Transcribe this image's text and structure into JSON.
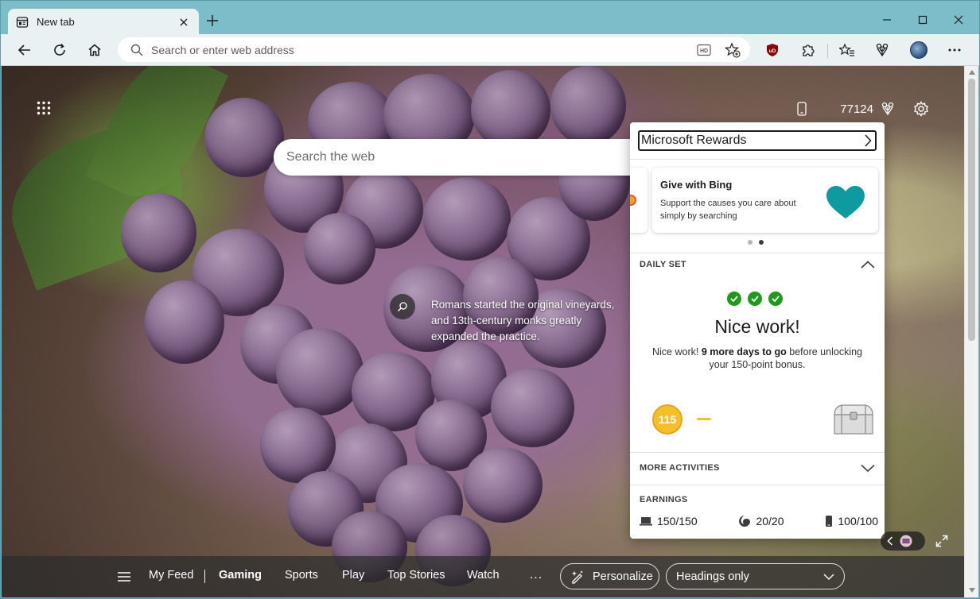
{
  "browser": {
    "tab": {
      "title": "New tab",
      "icon": "newtab-page-icon"
    },
    "address_bar": {
      "placeholder": "Search or enter web address",
      "icon": "search-icon"
    },
    "extensions": [
      "ublock-origin-icon",
      "puzzle-extensions-icon",
      "favorites-icon",
      "rewards-trophy-icon",
      "profile-avatar"
    ],
    "accent_color": "#7dbdc9",
    "ublock_badge_text": "uD"
  },
  "newtab": {
    "points": "77124",
    "search": {
      "placeholder": "Search the web"
    },
    "image_info": "Romans started the original vineyards, and 13th-century monks greatly expanded the practice."
  },
  "rewards": {
    "header": "Microsoft Rewards",
    "promo": {
      "title": "Give with Bing",
      "description": "Support the causes you care about simply by searching",
      "heart_color": "#0f9aa0"
    },
    "carousel": {
      "count": 2,
      "active": 2
    },
    "daily_set": {
      "label": "DAILY SET",
      "completed": 3,
      "title": "Nice work!",
      "desc_prefix": "Nice work! ",
      "desc_bold": "9 more days to go",
      "desc_suffix": " before unlocking your 150-point bonus.",
      "streak_points": "115"
    },
    "more_activities": {
      "label": "MORE ACTIVITIES"
    },
    "earnings": {
      "label": "EARNINGS",
      "pc_search": "150/150",
      "edge": "20/20",
      "mobile": "100/100"
    }
  },
  "bottom_nav": {
    "items": [
      {
        "label": "My Feed",
        "active": false
      },
      {
        "label": "Gaming",
        "active": true
      },
      {
        "label": "Sports",
        "active": false
      },
      {
        "label": "Play",
        "active": false
      },
      {
        "label": "Top Stories",
        "active": false
      },
      {
        "label": "Watch",
        "active": false
      }
    ],
    "more": "...",
    "personalize": "Personalize",
    "layout_select": "Headings only"
  }
}
